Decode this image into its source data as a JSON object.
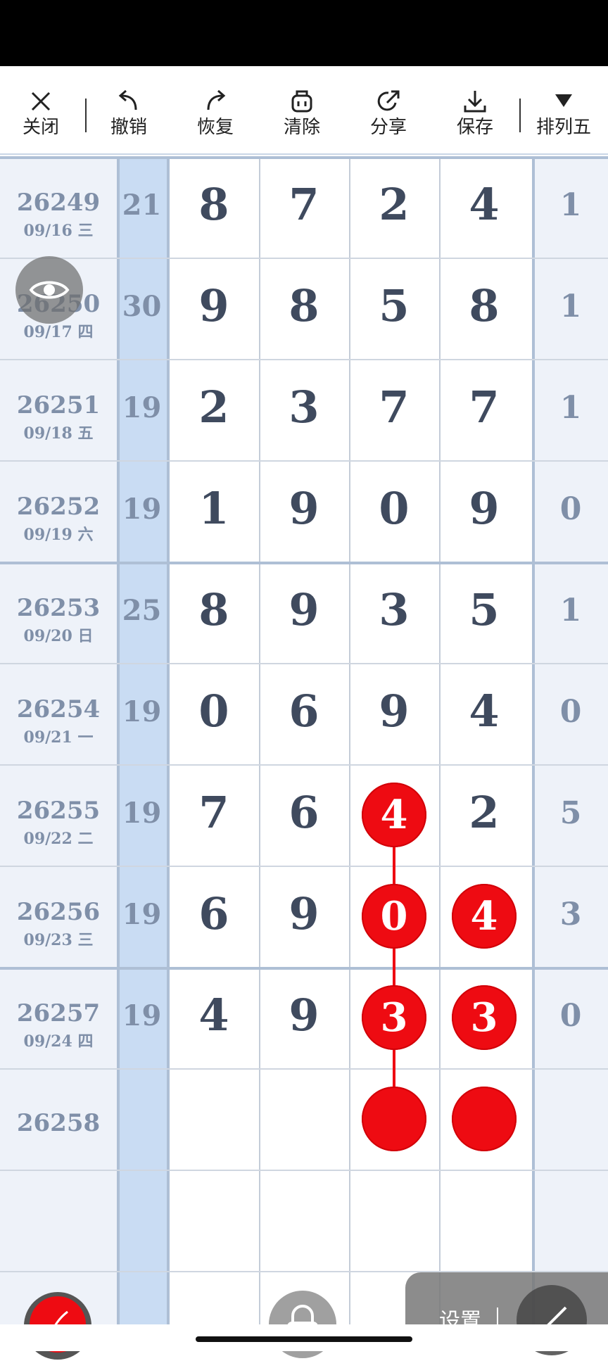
{
  "toolbar": {
    "close": "关闭",
    "undo": "撤销",
    "redo": "恢复",
    "clear": "清除",
    "share": "分享",
    "save": "保存",
    "game": "排列五"
  },
  "rows": [
    {
      "issue": "26249",
      "date": "09/16 三",
      "sum": "21",
      "digits": [
        "8",
        "7",
        "2",
        "4"
      ],
      "last": "1"
    },
    {
      "issue": "26250",
      "date": "09/17 四",
      "sum": "30",
      "digits": [
        "9",
        "8",
        "5",
        "8"
      ],
      "last": "1"
    },
    {
      "issue": "26251",
      "date": "09/18 五",
      "sum": "19",
      "digits": [
        "2",
        "3",
        "7",
        "7"
      ],
      "last": "1"
    },
    {
      "issue": "26252",
      "date": "09/19 六",
      "sum": "19",
      "digits": [
        "1",
        "9",
        "0",
        "9"
      ],
      "last": "0"
    },
    {
      "issue": "26253",
      "date": "09/20 日",
      "sum": "25",
      "digits": [
        "8",
        "9",
        "3",
        "5"
      ],
      "last": "1"
    },
    {
      "issue": "26254",
      "date": "09/21 一",
      "sum": "19",
      "digits": [
        "0",
        "6",
        "9",
        "4"
      ],
      "last": "0"
    },
    {
      "issue": "26255",
      "date": "09/22 二",
      "sum": "19",
      "digits": [
        "7",
        "6",
        "4",
        "2"
      ],
      "last": "5"
    },
    {
      "issue": "26256",
      "date": "09/23 三",
      "sum": "19",
      "digits": [
        "6",
        "9",
        "0",
        "4"
      ],
      "last": "3"
    },
    {
      "issue": "26257",
      "date": "09/24 四",
      "sum": "19",
      "digits": [
        "4",
        "9",
        "3",
        "3"
      ],
      "last": "0"
    },
    {
      "issue": "26258",
      "date": "",
      "sum": "",
      "digits": [
        "",
        "",
        "",
        ""
      ],
      "last": ""
    }
  ],
  "marks": {
    "col3": [
      "4",
      "0",
      "3",
      ""
    ],
    "col4": [
      "4",
      "3",
      ""
    ]
  },
  "bottom": {
    "settings": "设置"
  },
  "colors": {
    "accent_red": "#ee0b12",
    "sum_column": "#c9dcf3",
    "date_column": "#eef2f9"
  }
}
